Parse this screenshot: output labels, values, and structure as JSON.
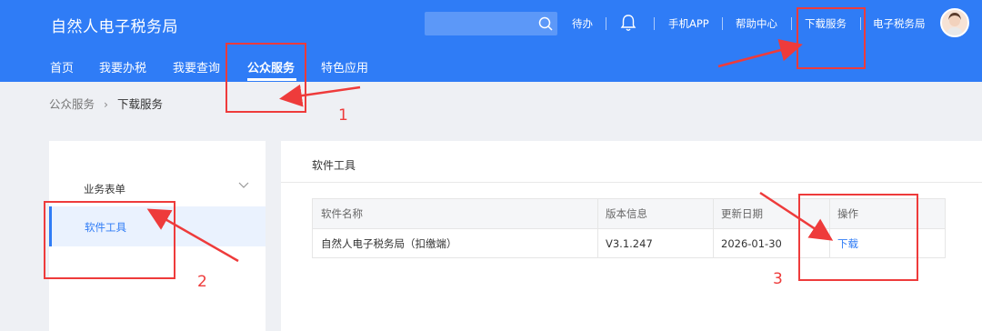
{
  "header": {
    "app_title": "自然人电子税务局",
    "search": {
      "placeholder": ""
    },
    "links": [
      "待办",
      "手机APP",
      "帮助中心",
      "下载服务",
      "电子税务局"
    ],
    "nav": [
      "首页",
      "我要办税",
      "我要查询",
      "公众服务",
      "特色应用"
    ],
    "active_nav": "公众服务"
  },
  "breadcrumb": {
    "parent": "公众服务",
    "separator": "›",
    "current": "下载服务"
  },
  "sidebar": {
    "group_label": "业务表单",
    "active_item": "软件工具"
  },
  "panel": {
    "title": "软件工具",
    "table": {
      "headers": [
        "软件名称",
        "版本信息",
        "更新日期",
        "操作"
      ],
      "rows": [
        [
          "自然人电子税务局（扣缴端）",
          "V3.1.247",
          "2026-01-30",
          "下载"
        ]
      ]
    }
  },
  "annotations": {
    "labels": [
      "1",
      "2",
      "3"
    ],
    "color": "#ee3b3b"
  },
  "colors": {
    "brand": "#2f7cf6",
    "annotation": "#ee3b3b"
  },
  "icons": [
    "search-icon",
    "bell-icon",
    "chevron-down-icon",
    "avatar"
  ]
}
